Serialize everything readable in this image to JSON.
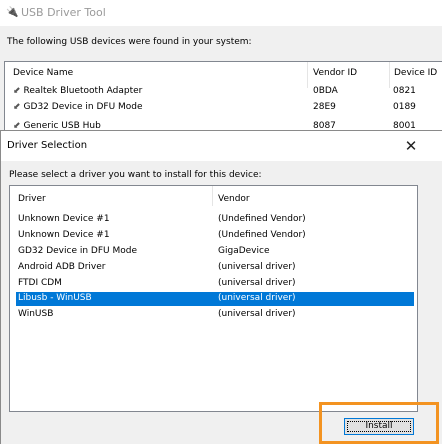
{
  "main_window": {
    "title": "USB Driver Tool",
    "instruction": "The following USB devices were found in your system:",
    "columns": [
      "Device Name",
      "Vendor ID",
      "Device ID"
    ],
    "rows": [
      {
        "name": "Realtek Bluetooth Adapter",
        "vendor_id": "0BDA",
        "device_id": "0821"
      },
      {
        "name": "GD32 Device in DFU Mode",
        "vendor_id": "28E9",
        "device_id": "0189"
      },
      {
        "name": "Generic USB Hub",
        "vendor_id": "8087",
        "device_id": "8001"
      }
    ]
  },
  "dialog": {
    "title": "Driver Selection",
    "close_glyph": "✕",
    "instruction": "Please select a driver you want to install for this device:",
    "columns": [
      "Driver",
      "Vendor"
    ],
    "rows": [
      {
        "driver": "Unknown Device #1",
        "vendor": "(Undefined Vendor)"
      },
      {
        "driver": "Unknown Device #1",
        "vendor": "(Undefined Vendor)"
      },
      {
        "driver": "GD32 Device in DFU Mode",
        "vendor": "GigaDevice"
      },
      {
        "driver": "Android ADB Driver",
        "vendor": "(universal driver)"
      },
      {
        "driver": "FTDI CDM",
        "vendor": "(universal driver)"
      },
      {
        "driver": "Libusb - WinUSB",
        "vendor": "(universal driver)",
        "selected": true
      },
      {
        "driver": "WinUSB",
        "vendor": "(universal driver)"
      }
    ],
    "install_label": "Install"
  },
  "colors": {
    "selection": "#0078d7",
    "highlight": "#f39321"
  },
  "icons": {
    "app": "usb-plug-icon",
    "device": "usb-plug-icon",
    "close": "close-icon"
  }
}
